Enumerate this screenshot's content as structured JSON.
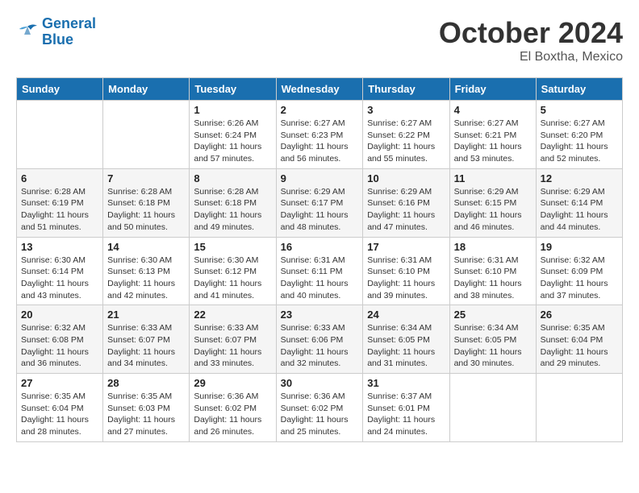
{
  "header": {
    "logo_line1": "General",
    "logo_line2": "Blue",
    "month": "October 2024",
    "location": "El Boxtha, Mexico"
  },
  "weekdays": [
    "Sunday",
    "Monday",
    "Tuesday",
    "Wednesday",
    "Thursday",
    "Friday",
    "Saturday"
  ],
  "weeks": [
    [
      {
        "day": "",
        "sunrise": "",
        "sunset": "",
        "daylight": ""
      },
      {
        "day": "",
        "sunrise": "",
        "sunset": "",
        "daylight": ""
      },
      {
        "day": "1",
        "sunrise": "Sunrise: 6:26 AM",
        "sunset": "Sunset: 6:24 PM",
        "daylight": "Daylight: 11 hours and 57 minutes."
      },
      {
        "day": "2",
        "sunrise": "Sunrise: 6:27 AM",
        "sunset": "Sunset: 6:23 PM",
        "daylight": "Daylight: 11 hours and 56 minutes."
      },
      {
        "day": "3",
        "sunrise": "Sunrise: 6:27 AM",
        "sunset": "Sunset: 6:22 PM",
        "daylight": "Daylight: 11 hours and 55 minutes."
      },
      {
        "day": "4",
        "sunrise": "Sunrise: 6:27 AM",
        "sunset": "Sunset: 6:21 PM",
        "daylight": "Daylight: 11 hours and 53 minutes."
      },
      {
        "day": "5",
        "sunrise": "Sunrise: 6:27 AM",
        "sunset": "Sunset: 6:20 PM",
        "daylight": "Daylight: 11 hours and 52 minutes."
      }
    ],
    [
      {
        "day": "6",
        "sunrise": "Sunrise: 6:28 AM",
        "sunset": "Sunset: 6:19 PM",
        "daylight": "Daylight: 11 hours and 51 minutes."
      },
      {
        "day": "7",
        "sunrise": "Sunrise: 6:28 AM",
        "sunset": "Sunset: 6:18 PM",
        "daylight": "Daylight: 11 hours and 50 minutes."
      },
      {
        "day": "8",
        "sunrise": "Sunrise: 6:28 AM",
        "sunset": "Sunset: 6:18 PM",
        "daylight": "Daylight: 11 hours and 49 minutes."
      },
      {
        "day": "9",
        "sunrise": "Sunrise: 6:29 AM",
        "sunset": "Sunset: 6:17 PM",
        "daylight": "Daylight: 11 hours and 48 minutes."
      },
      {
        "day": "10",
        "sunrise": "Sunrise: 6:29 AM",
        "sunset": "Sunset: 6:16 PM",
        "daylight": "Daylight: 11 hours and 47 minutes."
      },
      {
        "day": "11",
        "sunrise": "Sunrise: 6:29 AM",
        "sunset": "Sunset: 6:15 PM",
        "daylight": "Daylight: 11 hours and 46 minutes."
      },
      {
        "day": "12",
        "sunrise": "Sunrise: 6:29 AM",
        "sunset": "Sunset: 6:14 PM",
        "daylight": "Daylight: 11 hours and 44 minutes."
      }
    ],
    [
      {
        "day": "13",
        "sunrise": "Sunrise: 6:30 AM",
        "sunset": "Sunset: 6:14 PM",
        "daylight": "Daylight: 11 hours and 43 minutes."
      },
      {
        "day": "14",
        "sunrise": "Sunrise: 6:30 AM",
        "sunset": "Sunset: 6:13 PM",
        "daylight": "Daylight: 11 hours and 42 minutes."
      },
      {
        "day": "15",
        "sunrise": "Sunrise: 6:30 AM",
        "sunset": "Sunset: 6:12 PM",
        "daylight": "Daylight: 11 hours and 41 minutes."
      },
      {
        "day": "16",
        "sunrise": "Sunrise: 6:31 AM",
        "sunset": "Sunset: 6:11 PM",
        "daylight": "Daylight: 11 hours and 40 minutes."
      },
      {
        "day": "17",
        "sunrise": "Sunrise: 6:31 AM",
        "sunset": "Sunset: 6:10 PM",
        "daylight": "Daylight: 11 hours and 39 minutes."
      },
      {
        "day": "18",
        "sunrise": "Sunrise: 6:31 AM",
        "sunset": "Sunset: 6:10 PM",
        "daylight": "Daylight: 11 hours and 38 minutes."
      },
      {
        "day": "19",
        "sunrise": "Sunrise: 6:32 AM",
        "sunset": "Sunset: 6:09 PM",
        "daylight": "Daylight: 11 hours and 37 minutes."
      }
    ],
    [
      {
        "day": "20",
        "sunrise": "Sunrise: 6:32 AM",
        "sunset": "Sunset: 6:08 PM",
        "daylight": "Daylight: 11 hours and 36 minutes."
      },
      {
        "day": "21",
        "sunrise": "Sunrise: 6:33 AM",
        "sunset": "Sunset: 6:07 PM",
        "daylight": "Daylight: 11 hours and 34 minutes."
      },
      {
        "day": "22",
        "sunrise": "Sunrise: 6:33 AM",
        "sunset": "Sunset: 6:07 PM",
        "daylight": "Daylight: 11 hours and 33 minutes."
      },
      {
        "day": "23",
        "sunrise": "Sunrise: 6:33 AM",
        "sunset": "Sunset: 6:06 PM",
        "daylight": "Daylight: 11 hours and 32 minutes."
      },
      {
        "day": "24",
        "sunrise": "Sunrise: 6:34 AM",
        "sunset": "Sunset: 6:05 PM",
        "daylight": "Daylight: 11 hours and 31 minutes."
      },
      {
        "day": "25",
        "sunrise": "Sunrise: 6:34 AM",
        "sunset": "Sunset: 6:05 PM",
        "daylight": "Daylight: 11 hours and 30 minutes."
      },
      {
        "day": "26",
        "sunrise": "Sunrise: 6:35 AM",
        "sunset": "Sunset: 6:04 PM",
        "daylight": "Daylight: 11 hours and 29 minutes."
      }
    ],
    [
      {
        "day": "27",
        "sunrise": "Sunrise: 6:35 AM",
        "sunset": "Sunset: 6:04 PM",
        "daylight": "Daylight: 11 hours and 28 minutes."
      },
      {
        "day": "28",
        "sunrise": "Sunrise: 6:35 AM",
        "sunset": "Sunset: 6:03 PM",
        "daylight": "Daylight: 11 hours and 27 minutes."
      },
      {
        "day": "29",
        "sunrise": "Sunrise: 6:36 AM",
        "sunset": "Sunset: 6:02 PM",
        "daylight": "Daylight: 11 hours and 26 minutes."
      },
      {
        "day": "30",
        "sunrise": "Sunrise: 6:36 AM",
        "sunset": "Sunset: 6:02 PM",
        "daylight": "Daylight: 11 hours and 25 minutes."
      },
      {
        "day": "31",
        "sunrise": "Sunrise: 6:37 AM",
        "sunset": "Sunset: 6:01 PM",
        "daylight": "Daylight: 11 hours and 24 minutes."
      },
      {
        "day": "",
        "sunrise": "",
        "sunset": "",
        "daylight": ""
      },
      {
        "day": "",
        "sunrise": "",
        "sunset": "",
        "daylight": ""
      }
    ]
  ]
}
